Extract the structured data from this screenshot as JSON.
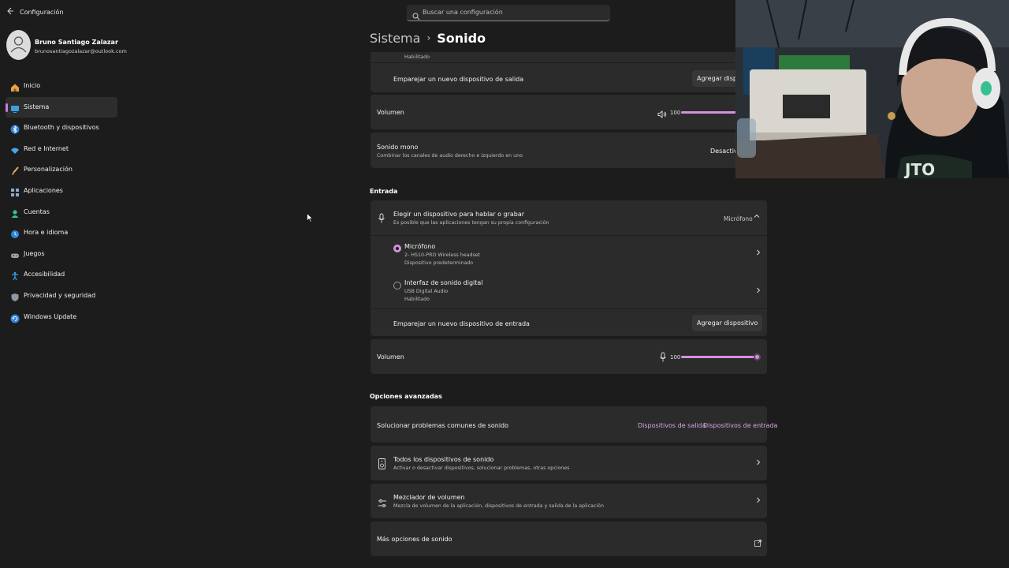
{
  "window": {
    "title": "Configuración"
  },
  "search": {
    "placeholder": "Buscar una configuración"
  },
  "profile": {
    "name": "Bruno Santiago Zalazar",
    "email": "brunosantiagozalazar@outlook.com"
  },
  "sidebar": {
    "items": [
      {
        "label": "Inicio",
        "icon": "home-icon"
      },
      {
        "label": "Sistema",
        "icon": "system-icon",
        "active": true
      },
      {
        "label": "Bluetooth y dispositivos",
        "icon": "bluetooth-icon"
      },
      {
        "label": "Red e Internet",
        "icon": "wifi-icon"
      },
      {
        "label": "Personalización",
        "icon": "brush-icon"
      },
      {
        "label": "Aplicaciones",
        "icon": "apps-icon"
      },
      {
        "label": "Cuentas",
        "icon": "account-icon"
      },
      {
        "label": "Hora e idioma",
        "icon": "globe-clock-icon"
      },
      {
        "label": "Juegos",
        "icon": "gamepad-icon"
      },
      {
        "label": "Accesibilidad",
        "icon": "accessibility-icon"
      },
      {
        "label": "Privacidad y seguridad",
        "icon": "shield-icon"
      },
      {
        "label": "Windows Update",
        "icon": "update-icon"
      }
    ]
  },
  "breadcrumb": {
    "parent": "Sistema",
    "separator": "›",
    "current": "Sonido"
  },
  "output": {
    "partial_status": "Habilitado",
    "pair_label": "Emparejar un nuevo dispositivo de salida",
    "pair_button": "Agregar dispositivo",
    "volume_label": "Volumen",
    "volume_value": "100",
    "volume_level": 1.0,
    "mono_title": "Sonido mono",
    "mono_sub": "Combinar los canales de audio derecho e izquierdo en uno",
    "mono_state": "Desactivado"
  },
  "input": {
    "section_title": "Entrada",
    "choose_title": "Elegir un dispositivo para hablar o grabar",
    "choose_sub": "Es posible que las aplicaciones tengan su propia configuración",
    "choose_value": "Micrófono",
    "devices": [
      {
        "name": "Micrófono",
        "detail": "2- HS10-PRO Wireless headset",
        "status": "Dispositivo predeterminado",
        "selected": true
      },
      {
        "name": "Interfaz de sonido digital",
        "detail": "USB Digital Audio",
        "status": "Habilitado",
        "selected": false
      }
    ],
    "pair_label": "Emparejar un nuevo dispositivo de entrada",
    "pair_button": "Agregar dispositivo",
    "volume_label": "Volumen",
    "volume_value": "100",
    "volume_level": 1.0
  },
  "advanced": {
    "section_title": "Opciones avanzadas",
    "troubleshoot_label": "Solucionar problemas comunes de sonido",
    "troubleshoot_output": "Dispositivos de salida",
    "troubleshoot_input": "Dispositivos de entrada",
    "all_devices_title": "Todos los dispositivos de sonido",
    "all_devices_sub": "Activar o desactivar dispositivos, solucionar problemas, otras opciones",
    "mixer_title": "Mezclador de volumen",
    "mixer_sub": "Mezcla de volumen de la aplicación, dispositivos de entrada y salida de la aplicación",
    "more_options": "Más opciones de sonido"
  },
  "colors": {
    "accent": "#d58fe0",
    "background": "#1c1c1c",
    "card": "#2b2b2b"
  }
}
